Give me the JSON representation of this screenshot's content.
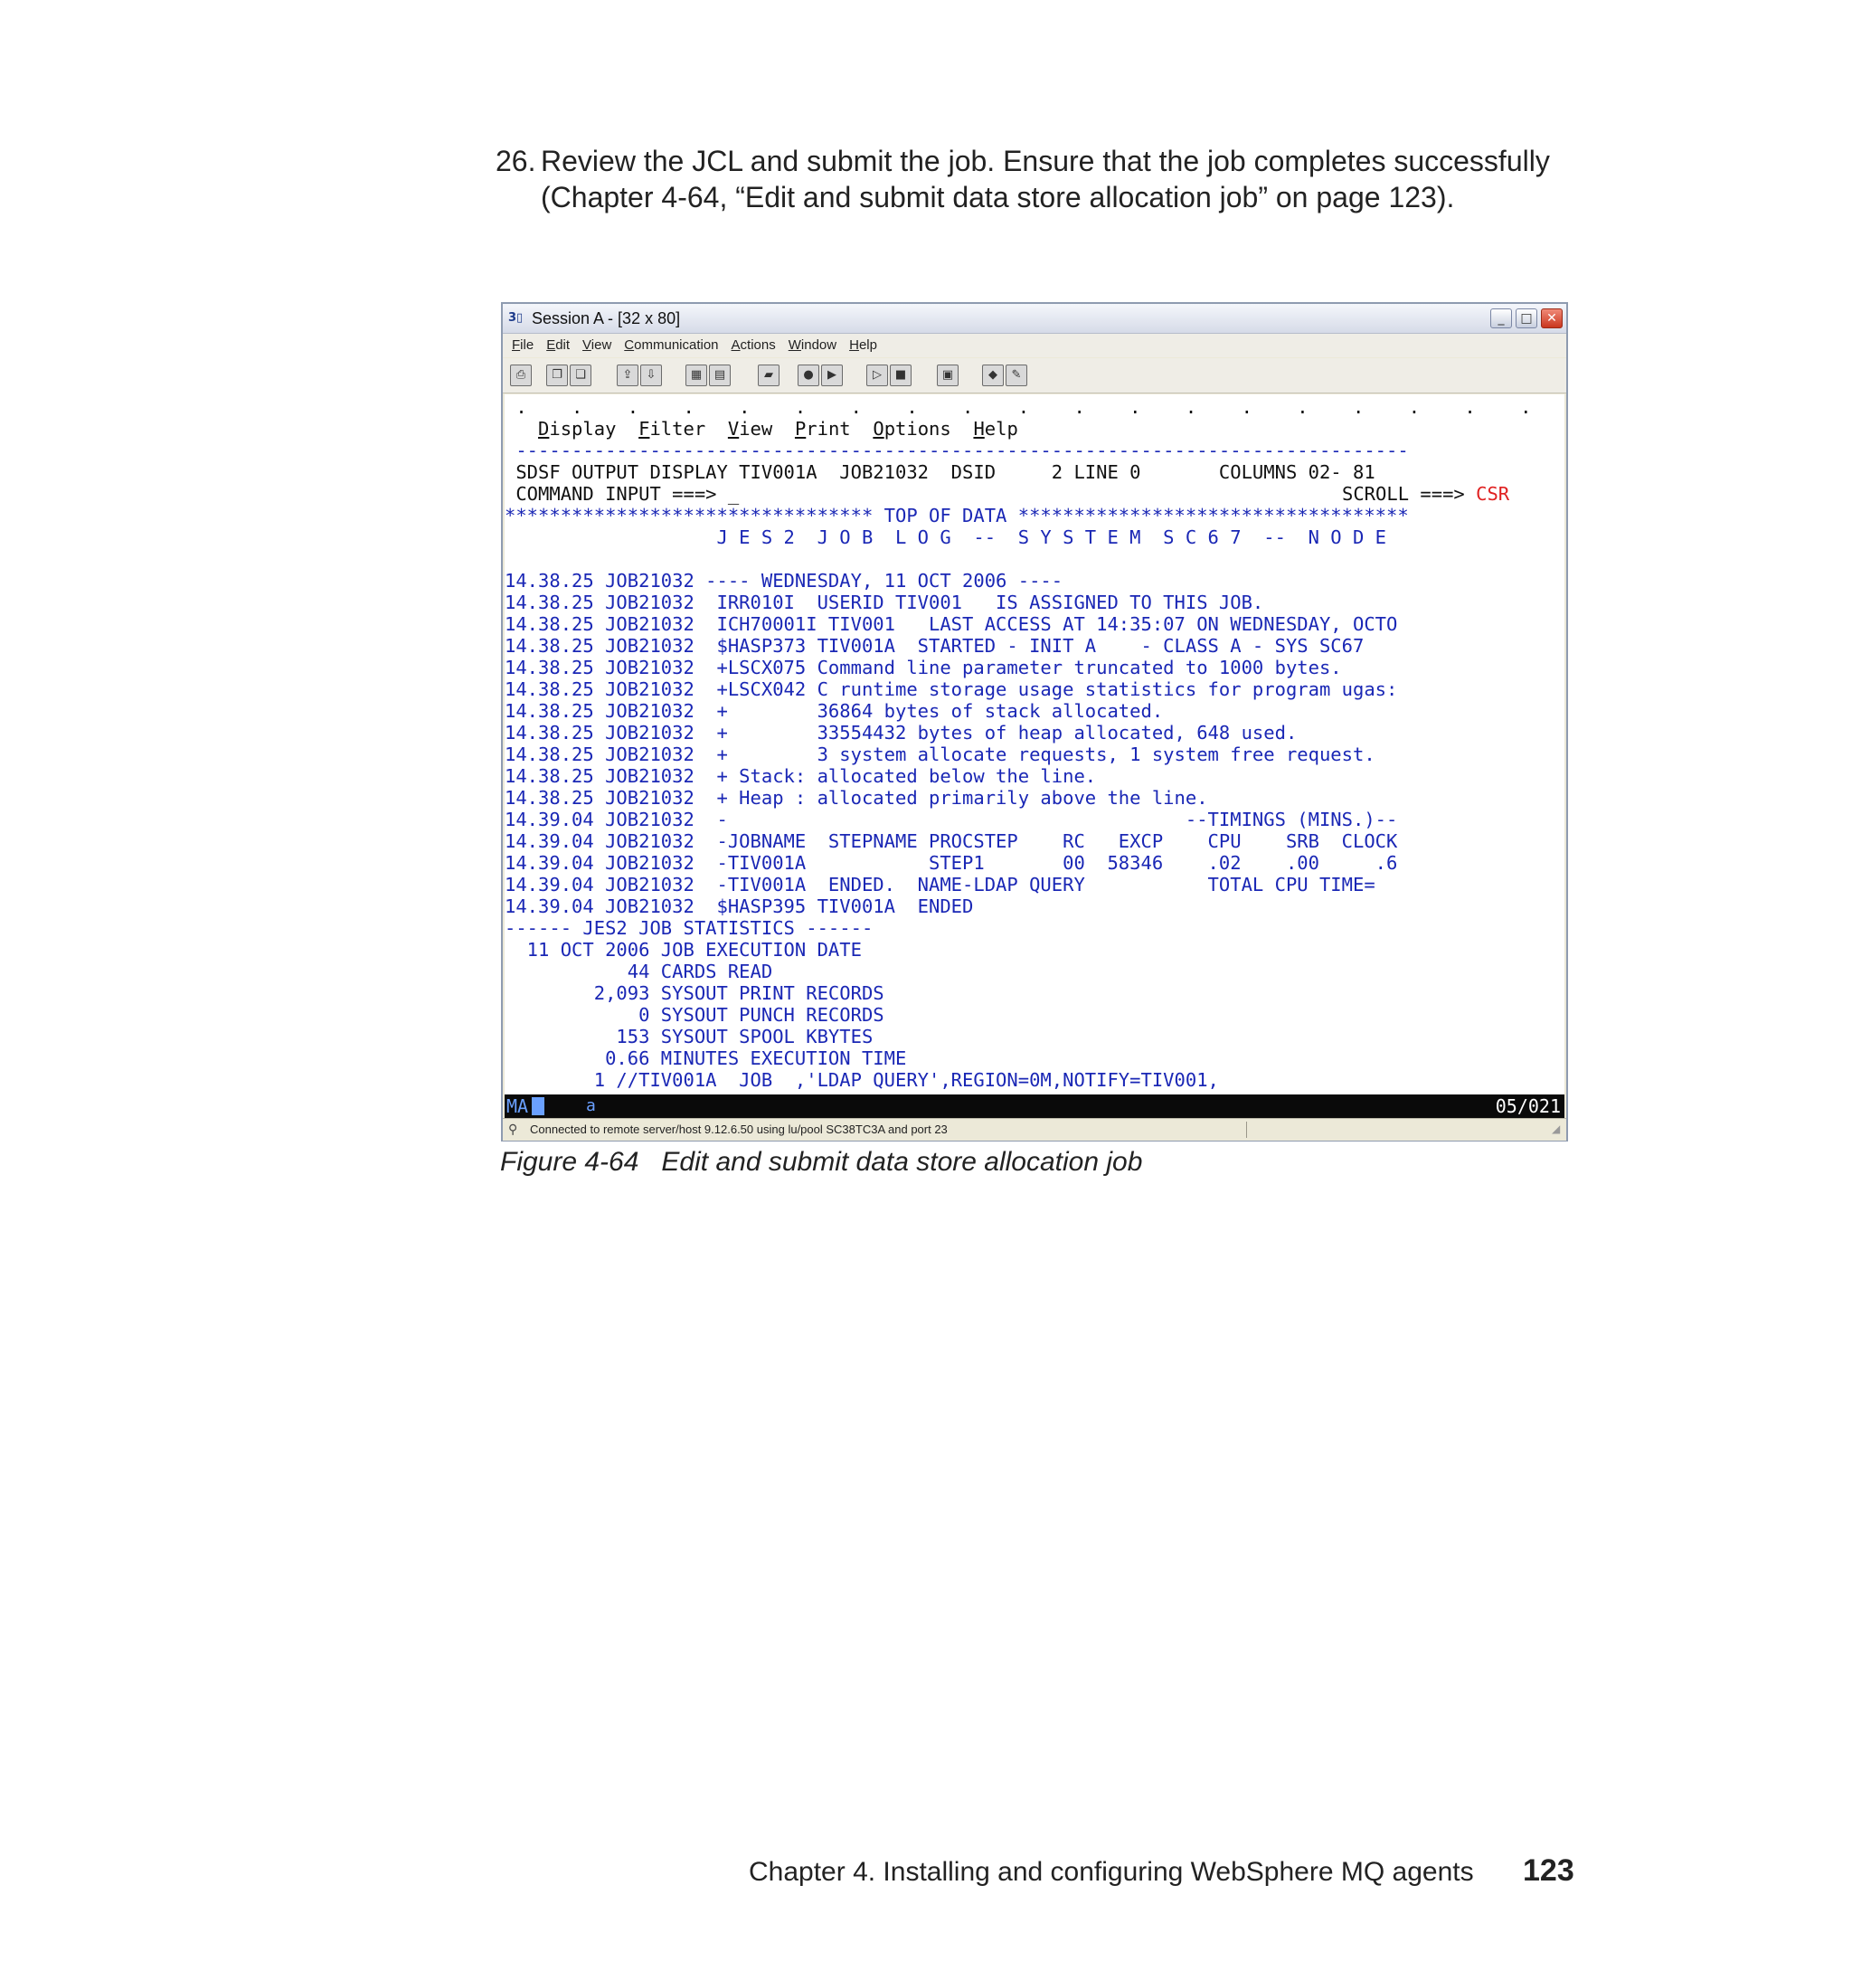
{
  "document": {
    "step_number": "26.",
    "step_text": "Review the JCL and submit the job. Ensure that the job completes successfully (Chapter 4-64, “Edit and submit data store allocation job” on page 123).",
    "caption": "Figure 4-64   Edit and submit data store allocation job",
    "footer_chapter": "Chapter 4. Installing and configuring WebSphere MQ agents",
    "footer_page": "123"
  },
  "window": {
    "title": "Session A - [32 x 80]",
    "menu": [
      "File",
      "Edit",
      "View",
      "Communication",
      "Actions",
      "Window",
      "Help"
    ],
    "toolbar_icons": [
      "print-screen-icon",
      "copy-icon",
      "paste-icon",
      "send-icon",
      "receive-icon",
      "display-icon",
      "keypad-icon",
      "macro-icon",
      "record-icon",
      "play-icon",
      "start-macro-icon",
      "stop-macro-icon",
      "clipboard-icon",
      "color-icon",
      "map-icon"
    ],
    "status": {
      "mode": "MA",
      "indicator": "a",
      "position": "05/021"
    },
    "connection": "Connected to remote server/host 9.12.6.50 using lu/pool SC38TC3A and port 23"
  },
  "terminal": {
    "dots": " .    .    .    .    .    .    .    .    .    .    .    .    .    .    .    .    .    .    .    .    .    .    .    .    .    .    .    .    .    .    .    .    .",
    "pulldown": [
      "Display",
      "Filter",
      "View",
      "Print",
      "Options",
      "Help"
    ],
    "separator": " --------------------------------------------------------------------------------",
    "header_line": " SDSF OUTPUT DISPLAY TIV001A  JOB21032  DSID     2 LINE 0       COLUMNS 02- 81",
    "command_label": " COMMAND INPUT ===>",
    "scroll_label": "SCROLL ===>",
    "scroll_value": "CSR",
    "top_of_data": "********************************* TOP OF DATA ***********************************",
    "jes_header": "                   J E S 2  J O B  L O G  --  S Y S T E M  S C 6 7  --  N O D E",
    "lines": [
      "",
      "14.38.25 JOB21032 ---- WEDNESDAY, 11 OCT 2006 ----",
      "14.38.25 JOB21032  IRR010I  USERID TIV001   IS ASSIGNED TO THIS JOB.",
      "14.38.25 JOB21032  ICH70001I TIV001   LAST ACCESS AT 14:35:07 ON WEDNESDAY, OCTO",
      "14.38.25 JOB21032  $HASP373 TIV001A  STARTED - INIT A    - CLASS A - SYS SC67",
      "14.38.25 JOB21032  +LSCX075 Command line parameter truncated to 1000 bytes.",
      "14.38.25 JOB21032  +LSCX042 C runtime storage usage statistics for program ugas:",
      "14.38.25 JOB21032  +        36864 bytes of stack allocated.",
      "14.38.25 JOB21032  +        33554432 bytes of heap allocated, 648 used.",
      "14.38.25 JOB21032  +        3 system allocate requests, 1 system free request.",
      "14.38.25 JOB21032  + Stack: allocated below the line.",
      "14.38.25 JOB21032  + Heap : allocated primarily above the line.",
      "14.39.04 JOB21032  -                                         --TIMINGS (MINS.)--",
      "14.39.04 JOB21032  -JOBNAME  STEPNAME PROCSTEP    RC   EXCP    CPU    SRB  CLOCK",
      "14.39.04 JOB21032  -TIV001A           STEP1       00  58346    .02    .00     .6",
      "14.39.04 JOB21032  -TIV001A  ENDED.  NAME-LDAP QUERY           TOTAL CPU TIME=",
      "14.39.04 JOB21032  $HASP395 TIV001A  ENDED",
      "------ JES2 JOB STATISTICS ------",
      "  11 OCT 2006 JOB EXECUTION DATE",
      "           44 CARDS READ",
      "        2,093 SYSOUT PRINT RECORDS",
      "            0 SYSOUT PUNCH RECORDS",
      "          153 SYSOUT SPOOL KBYTES",
      "         0.66 MINUTES EXECUTION TIME",
      "        1 //TIV001A  JOB  ,'LDAP QUERY',REGION=0M,NOTIFY=TIV001,"
    ]
  }
}
